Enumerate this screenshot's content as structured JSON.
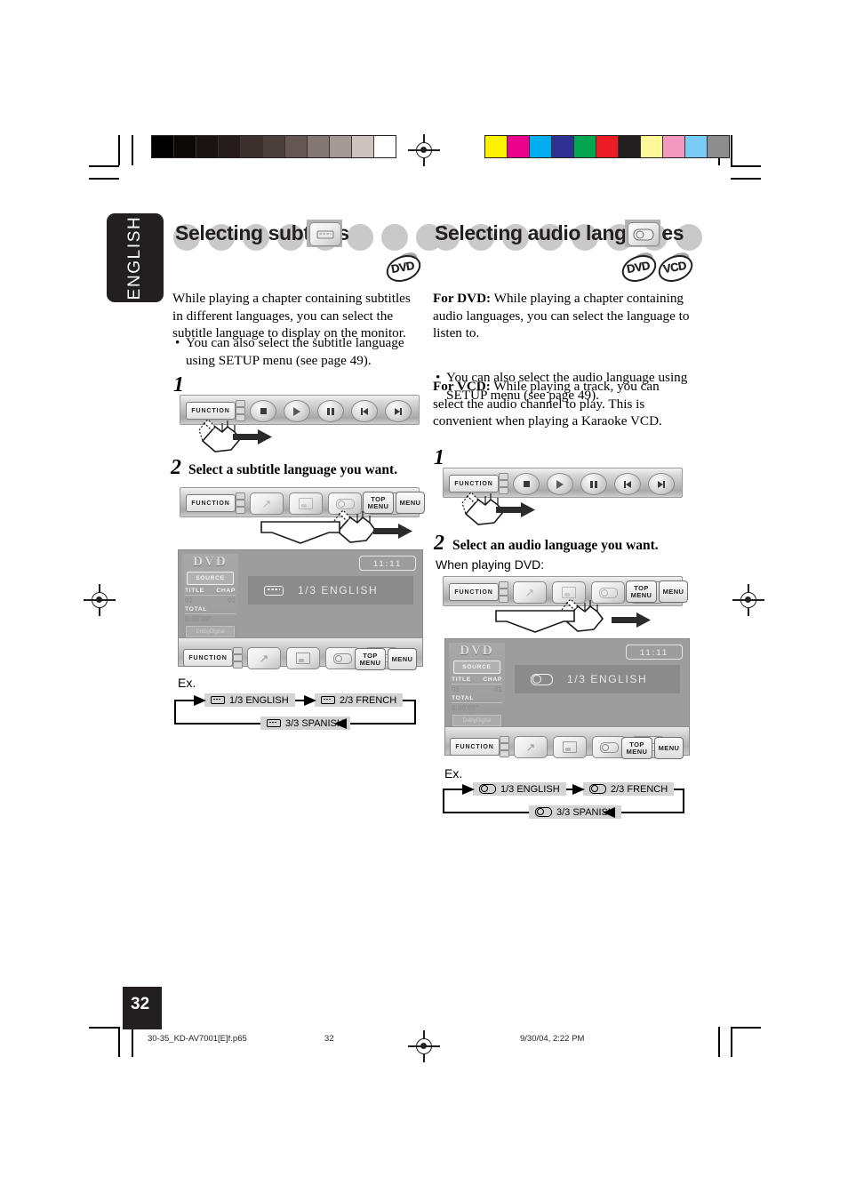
{
  "page": {
    "language_tab": "ENGLISH",
    "page_number": "32",
    "footer": {
      "filename": "30-35_KD-AV7001[E]f.p65",
      "page": "32",
      "timestamp": "9/30/04, 2:22 PM"
    }
  },
  "colorbars": {
    "grayscale": [
      "#000000",
      "#0d0909",
      "#191312",
      "#241d1b",
      "#3b302d",
      "#4c403d",
      "#645753",
      "#837773",
      "#a39a95",
      "#cdc4c0",
      "#ffffff"
    ],
    "chromatic": [
      "#fff200",
      "#ec008c",
      "#00aeef",
      "#2e3192",
      "#00a651",
      "#ed1c24",
      "#231f20",
      "#fff799",
      "#f49ac1",
      "#7accf4",
      "#8d8d8d"
    ]
  },
  "left_section": {
    "title": "Selecting subtitles",
    "key_icon": "subtitle-key-icon",
    "discs": [
      "DVD"
    ],
    "intro": "While playing a chapter containing subtitles in different languages, you can select the subtitle language to display on the monitor.",
    "bullet": "You can also select the subtitle language using SETUP menu (see page 49).",
    "step1": {
      "number": "1"
    },
    "step2": {
      "number": "2",
      "text": "Select a subtitle language you want."
    },
    "ex_label": "Ex.",
    "flow": [
      {
        "icon": "subtitle-icon",
        "label": "1/3 ENGLISH"
      },
      {
        "icon": "subtitle-icon",
        "label": "2/3 FRENCH"
      },
      {
        "icon": "subtitle-icon",
        "label": "3/3 SPANISH"
      }
    ],
    "monitor": {
      "source_title": "DVD",
      "source_button": "SOURCE",
      "title_label": "TITLE",
      "chap_label": "CHAP",
      "title_value": "01",
      "chap_value": "01",
      "total_label": "TOTAL",
      "total_value": "0:00'09\"",
      "dolby": "DolbyDigital",
      "eq": "FLAT",
      "digital": "Digital",
      "clock": "11:11",
      "osd_icon": "subtitle-icon",
      "osd_text": "1/3  ENGLISH"
    }
  },
  "right_section": {
    "title": "Selecting audio languages",
    "key_icon": "audio-key-icon",
    "discs": [
      "DVD",
      "VCD"
    ],
    "para_dvd_lead": "For DVD:",
    "para_dvd": " While playing a chapter containing audio languages, you can select the language to listen to.",
    "bullet": "You can also select the audio language using SETUP menu (see page 49).",
    "para_vcd_lead": "For VCD:",
    "para_vcd": " While playing a track, you can select the audio channel to play. This is convenient when playing a Karaoke VCD.",
    "step1": {
      "number": "1"
    },
    "step2": {
      "number": "2",
      "text": "Select an audio language you want.",
      "subtext": "When playing DVD:"
    },
    "ex_label": "Ex.",
    "flow": [
      {
        "icon": "audio-icon",
        "label": "1/3 ENGLISH"
      },
      {
        "icon": "audio-icon",
        "label": "2/3 FRENCH"
      },
      {
        "icon": "audio-icon",
        "label": "3/3 SPANISH"
      }
    ],
    "monitor": {
      "source_title": "DVD",
      "source_button": "SOURCE",
      "title_label": "TITLE",
      "chap_label": "CHAP",
      "title_value": "01",
      "chap_value": "01",
      "total_label": "TOTAL",
      "total_value": "0:00'09\"",
      "dolby": "DolbyDigital",
      "eq": "FLAT",
      "digital": "Digital",
      "clock": "11:11",
      "osd_icon": "audio-icon",
      "osd_text": "1/3  ENGLISH"
    }
  },
  "controlbar": {
    "function_label": "FUNCTION",
    "transport_buttons": [
      "stop",
      "play",
      "pause",
      "previous",
      "next"
    ],
    "function_buttons": [
      "angle",
      "zoom",
      "audio",
      "subtitle"
    ],
    "top_menu_line1": "TOP",
    "top_menu_line2": "MENU",
    "menu_label": "MENU"
  }
}
